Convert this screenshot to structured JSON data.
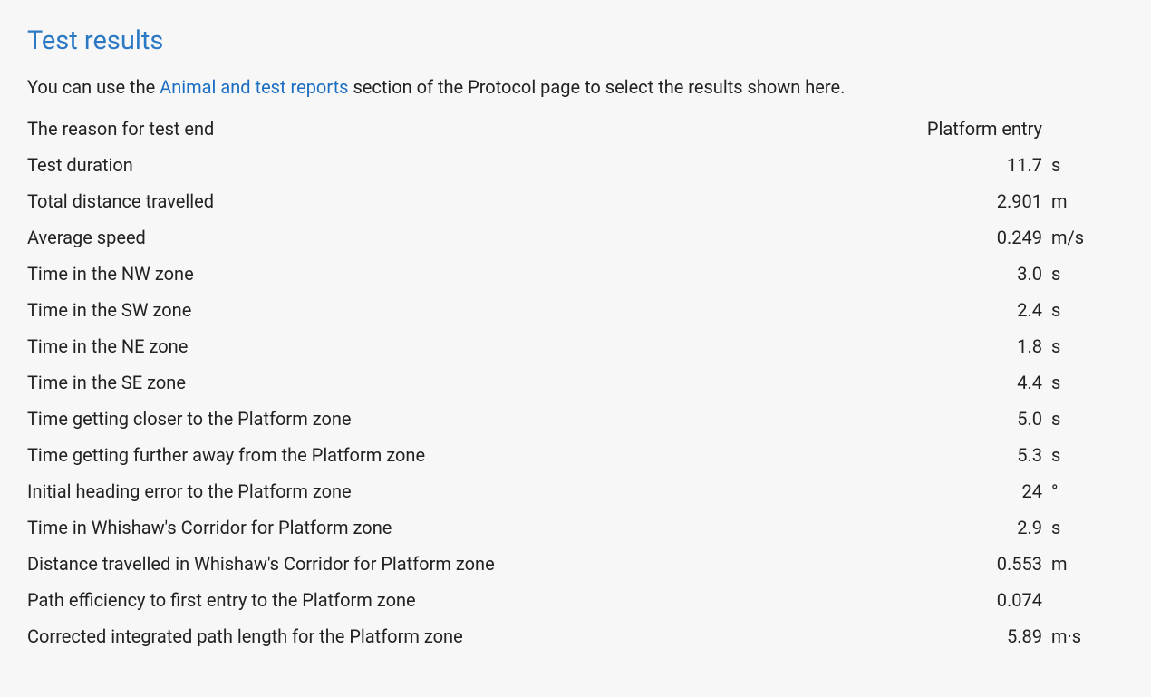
{
  "section_title": "Test results",
  "intro": {
    "before_link": "You can use the ",
    "link_text": "Animal and test reports",
    "after_link": " section of the Protocol page to select the results shown here."
  },
  "rows": [
    {
      "label": "The reason for test end",
      "value": "Platform entry",
      "unit": ""
    },
    {
      "label": "Test duration",
      "value": "11.7",
      "unit": "s"
    },
    {
      "label": "Total distance travelled",
      "value": "2.901",
      "unit": "m"
    },
    {
      "label": "Average speed",
      "value": "0.249",
      "unit": "m/s"
    },
    {
      "label": "Time in the NW zone",
      "value": "3.0",
      "unit": "s"
    },
    {
      "label": "Time in the SW zone",
      "value": "2.4",
      "unit": "s"
    },
    {
      "label": "Time in the NE zone",
      "value": "1.8",
      "unit": "s"
    },
    {
      "label": "Time in the SE zone",
      "value": "4.4",
      "unit": "s"
    },
    {
      "label": "Time getting closer to the Platform zone",
      "value": "5.0",
      "unit": "s"
    },
    {
      "label": "Time getting further away from the Platform zone",
      "value": "5.3",
      "unit": "s"
    },
    {
      "label": "Initial heading error to the Platform zone",
      "value": "24",
      "unit": "°"
    },
    {
      "label": "Time in Whishaw's Corridor for Platform zone",
      "value": "2.9",
      "unit": "s"
    },
    {
      "label": "Distance travelled in Whishaw's Corridor for Platform zone",
      "value": "0.553",
      "unit": "m"
    },
    {
      "label": "Path efficiency to first entry to the Platform zone",
      "value": "0.074",
      "unit": ""
    },
    {
      "label": "Corrected integrated path length for the Platform zone",
      "value": "5.89",
      "unit": "m·s"
    }
  ]
}
